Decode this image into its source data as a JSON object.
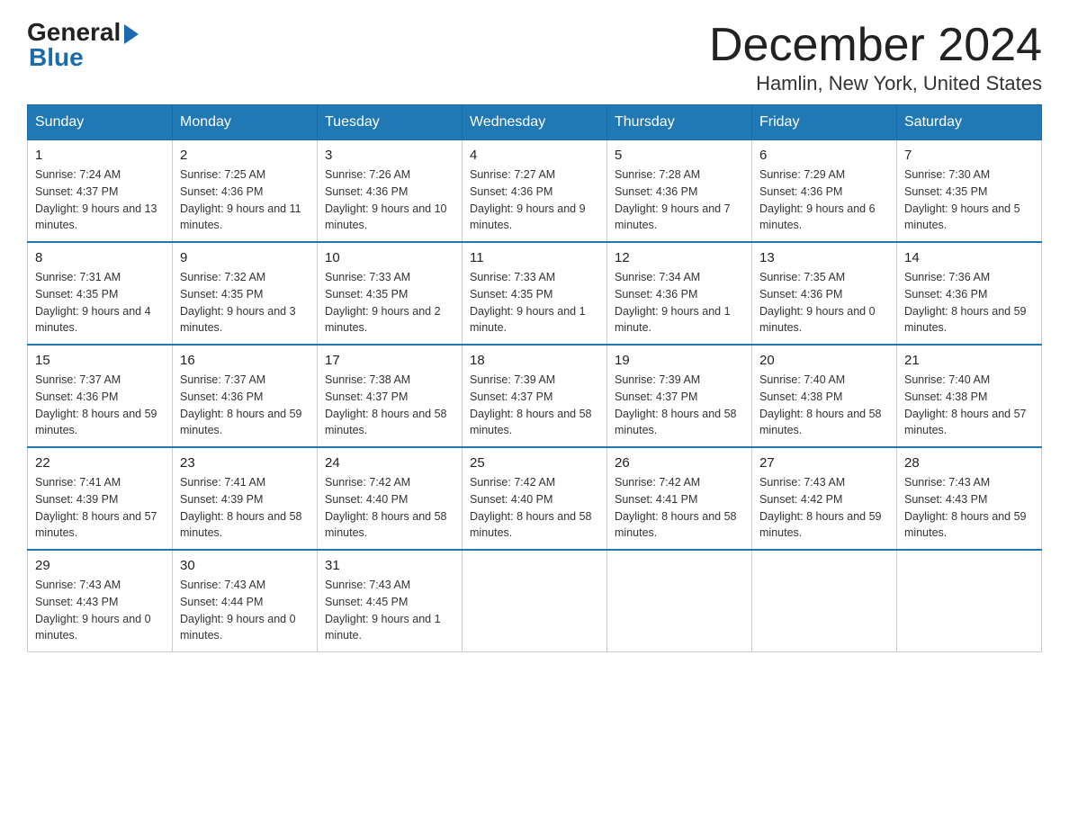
{
  "logo": {
    "general": "General",
    "blue": "Blue"
  },
  "title": "December 2024",
  "location": "Hamlin, New York, United States",
  "days_header": [
    "Sunday",
    "Monday",
    "Tuesday",
    "Wednesday",
    "Thursday",
    "Friday",
    "Saturday"
  ],
  "weeks": [
    [
      {
        "num": "1",
        "sunrise": "7:24 AM",
        "sunset": "4:37 PM",
        "daylight": "9 hours and 13 minutes."
      },
      {
        "num": "2",
        "sunrise": "7:25 AM",
        "sunset": "4:36 PM",
        "daylight": "9 hours and 11 minutes."
      },
      {
        "num": "3",
        "sunrise": "7:26 AM",
        "sunset": "4:36 PM",
        "daylight": "9 hours and 10 minutes."
      },
      {
        "num": "4",
        "sunrise": "7:27 AM",
        "sunset": "4:36 PM",
        "daylight": "9 hours and 9 minutes."
      },
      {
        "num": "5",
        "sunrise": "7:28 AM",
        "sunset": "4:36 PM",
        "daylight": "9 hours and 7 minutes."
      },
      {
        "num": "6",
        "sunrise": "7:29 AM",
        "sunset": "4:36 PM",
        "daylight": "9 hours and 6 minutes."
      },
      {
        "num": "7",
        "sunrise": "7:30 AM",
        "sunset": "4:35 PM",
        "daylight": "9 hours and 5 minutes."
      }
    ],
    [
      {
        "num": "8",
        "sunrise": "7:31 AM",
        "sunset": "4:35 PM",
        "daylight": "9 hours and 4 minutes."
      },
      {
        "num": "9",
        "sunrise": "7:32 AM",
        "sunset": "4:35 PM",
        "daylight": "9 hours and 3 minutes."
      },
      {
        "num": "10",
        "sunrise": "7:33 AM",
        "sunset": "4:35 PM",
        "daylight": "9 hours and 2 minutes."
      },
      {
        "num": "11",
        "sunrise": "7:33 AM",
        "sunset": "4:35 PM",
        "daylight": "9 hours and 1 minute."
      },
      {
        "num": "12",
        "sunrise": "7:34 AM",
        "sunset": "4:36 PM",
        "daylight": "9 hours and 1 minute."
      },
      {
        "num": "13",
        "sunrise": "7:35 AM",
        "sunset": "4:36 PM",
        "daylight": "9 hours and 0 minutes."
      },
      {
        "num": "14",
        "sunrise": "7:36 AM",
        "sunset": "4:36 PM",
        "daylight": "8 hours and 59 minutes."
      }
    ],
    [
      {
        "num": "15",
        "sunrise": "7:37 AM",
        "sunset": "4:36 PM",
        "daylight": "8 hours and 59 minutes."
      },
      {
        "num": "16",
        "sunrise": "7:37 AM",
        "sunset": "4:36 PM",
        "daylight": "8 hours and 59 minutes."
      },
      {
        "num": "17",
        "sunrise": "7:38 AM",
        "sunset": "4:37 PM",
        "daylight": "8 hours and 58 minutes."
      },
      {
        "num": "18",
        "sunrise": "7:39 AM",
        "sunset": "4:37 PM",
        "daylight": "8 hours and 58 minutes."
      },
      {
        "num": "19",
        "sunrise": "7:39 AM",
        "sunset": "4:37 PM",
        "daylight": "8 hours and 58 minutes."
      },
      {
        "num": "20",
        "sunrise": "7:40 AM",
        "sunset": "4:38 PM",
        "daylight": "8 hours and 58 minutes."
      },
      {
        "num": "21",
        "sunrise": "7:40 AM",
        "sunset": "4:38 PM",
        "daylight": "8 hours and 57 minutes."
      }
    ],
    [
      {
        "num": "22",
        "sunrise": "7:41 AM",
        "sunset": "4:39 PM",
        "daylight": "8 hours and 57 minutes."
      },
      {
        "num": "23",
        "sunrise": "7:41 AM",
        "sunset": "4:39 PM",
        "daylight": "8 hours and 58 minutes."
      },
      {
        "num": "24",
        "sunrise": "7:42 AM",
        "sunset": "4:40 PM",
        "daylight": "8 hours and 58 minutes."
      },
      {
        "num": "25",
        "sunrise": "7:42 AM",
        "sunset": "4:40 PM",
        "daylight": "8 hours and 58 minutes."
      },
      {
        "num": "26",
        "sunrise": "7:42 AM",
        "sunset": "4:41 PM",
        "daylight": "8 hours and 58 minutes."
      },
      {
        "num": "27",
        "sunrise": "7:43 AM",
        "sunset": "4:42 PM",
        "daylight": "8 hours and 59 minutes."
      },
      {
        "num": "28",
        "sunrise": "7:43 AM",
        "sunset": "4:43 PM",
        "daylight": "8 hours and 59 minutes."
      }
    ],
    [
      {
        "num": "29",
        "sunrise": "7:43 AM",
        "sunset": "4:43 PM",
        "daylight": "9 hours and 0 minutes."
      },
      {
        "num": "30",
        "sunrise": "7:43 AM",
        "sunset": "4:44 PM",
        "daylight": "9 hours and 0 minutes."
      },
      {
        "num": "31",
        "sunrise": "7:43 AM",
        "sunset": "4:45 PM",
        "daylight": "9 hours and 1 minute."
      },
      null,
      null,
      null,
      null
    ]
  ]
}
